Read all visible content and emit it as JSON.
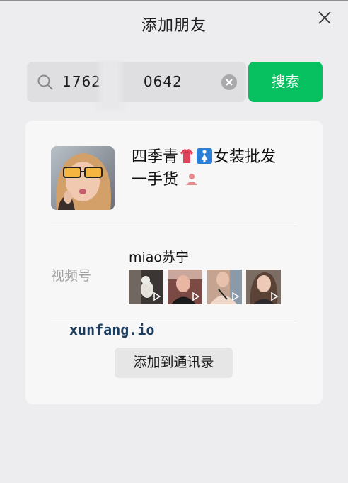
{
  "header": {
    "title": "添加朋友"
  },
  "search": {
    "query_start": "1762",
    "query_end": "0642",
    "button_label": "搜索"
  },
  "result": {
    "name_part1": "四季青",
    "name_part2": "女装批发",
    "name_part3": "一手货",
    "channels_label": "视频号",
    "channel_name": "miao苏宁",
    "add_button_label": "添加到通讯录"
  },
  "watermark": "xunfang.io",
  "colors": {
    "accent": "#07c160",
    "background": "#ededef",
    "card": "#f7f7f7"
  },
  "icons": [
    "close-icon",
    "search-icon",
    "clear-icon",
    "shirt-emoji",
    "woman-sign-emoji",
    "person-emoji",
    "play-icon"
  ]
}
